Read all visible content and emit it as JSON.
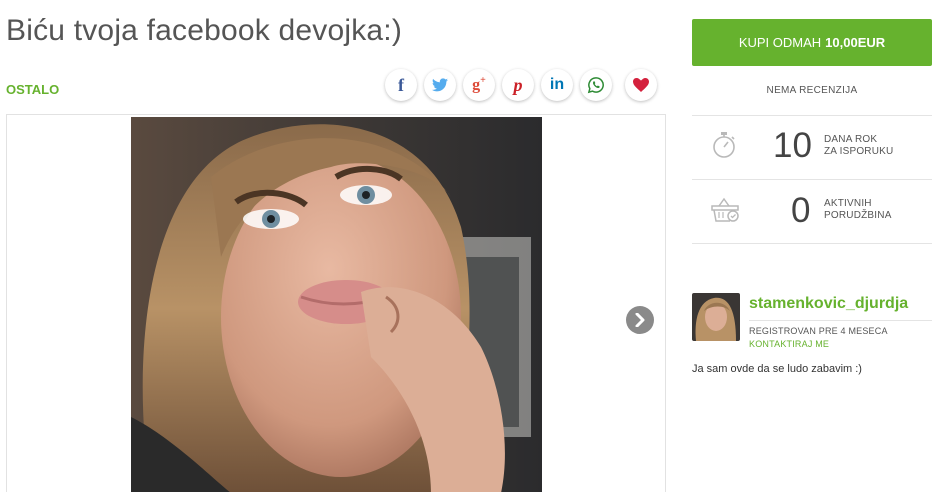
{
  "product": {
    "title": "Biću tvoja facebook devojka:)",
    "category": "OSTALO"
  },
  "share": {
    "icons": [
      {
        "name": "facebook-icon",
        "glyph": "f",
        "color": "#3b5998"
      },
      {
        "name": "twitter-icon",
        "glyph": "🐦",
        "color": "#55acee"
      },
      {
        "name": "google-plus-icon",
        "glyph": "g+",
        "color": "#dd4b39"
      },
      {
        "name": "pinterest-icon",
        "glyph": "p",
        "color": "#cb2027"
      },
      {
        "name": "linkedin-icon",
        "glyph": "in",
        "color": "#0077b5"
      },
      {
        "name": "whatsapp-icon",
        "glyph": "☎",
        "color": "#2e8b35"
      },
      {
        "name": "heart-icon",
        "glyph": "♥",
        "color": "#d4213d"
      }
    ]
  },
  "buy": {
    "label": "KUPI ODMAH",
    "price": "10,00EUR",
    "color": "#66b22e"
  },
  "reviews": "NEMA RECENZIJA",
  "stats": [
    {
      "icon": "stopwatch-icon",
      "value": "10",
      "label_line1": "DANA ROK",
      "label_line2": "ZA ISPORUKU"
    },
    {
      "icon": "shopping-basket-icon",
      "value": "0",
      "label_line1": "AKTIVNIH",
      "label_line2": "PORUDŽBINA"
    }
  ],
  "seller": {
    "username": "stamenkovic_djurdja",
    "registered": "REGISTROVAN PRE 4 MESECA",
    "contact": "KONTAKTIRAJ ME",
    "bio": "Ja sam ovde da se ludo zabavim :)"
  }
}
